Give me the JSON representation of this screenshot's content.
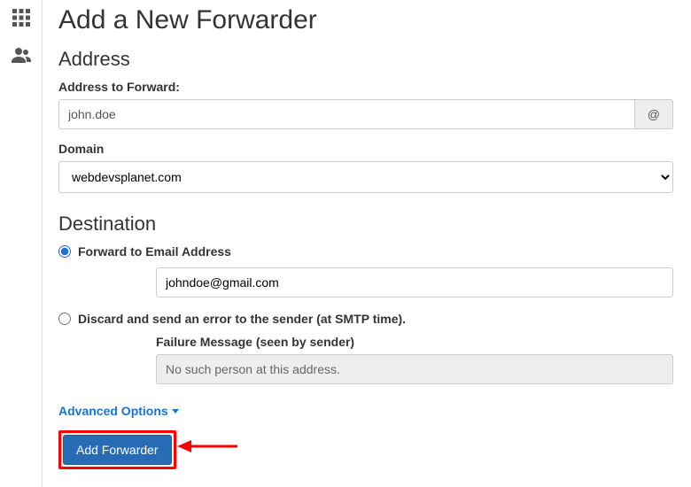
{
  "page": {
    "title": "Add a New Forwarder"
  },
  "address": {
    "heading": "Address",
    "label": "Address to Forward:",
    "value": "john.doe",
    "addon": "@",
    "domain_label": "Domain",
    "domain_value": "webdevsplanet.com"
  },
  "destination": {
    "heading": "Destination",
    "opt_forward": "Forward to Email Address",
    "forward_value": "johndoe@gmail.com",
    "opt_discard": "Discard and send an error to the sender (at SMTP time).",
    "failure_label": "Failure Message (seen by sender)",
    "failure_value": "No such person at this address."
  },
  "advanced_label": "Advanced Options",
  "submit_label": "Add Forwarder"
}
